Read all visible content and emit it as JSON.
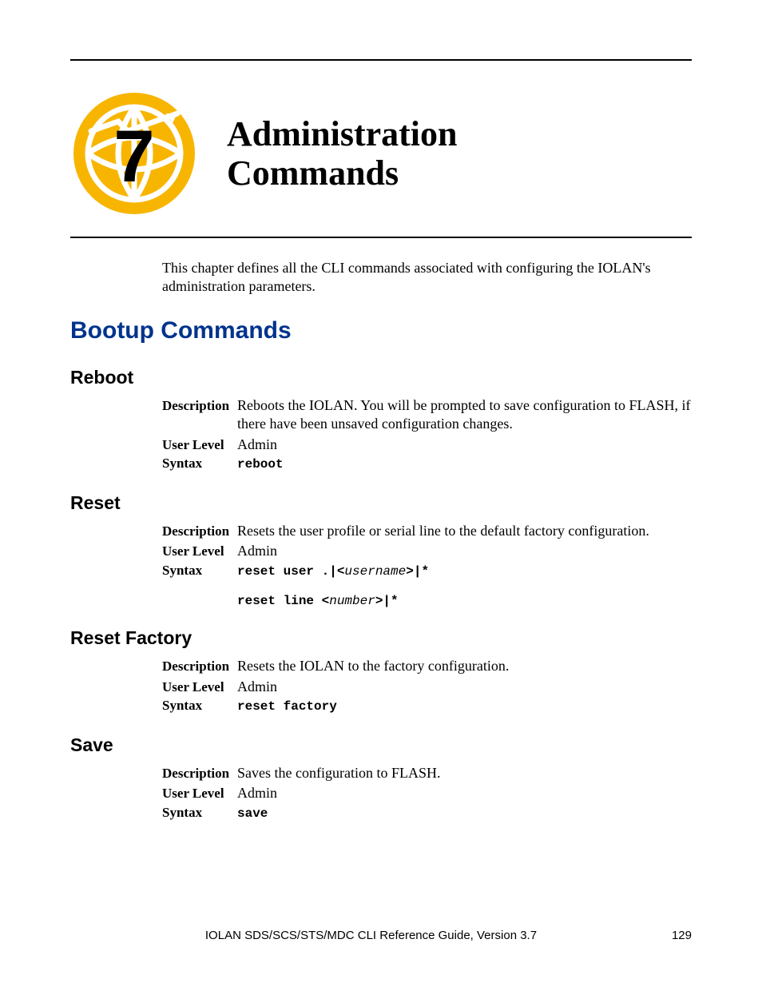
{
  "chapter": {
    "number": "7",
    "title_line1": "Administration",
    "title_line2": "Commands"
  },
  "intro": "This chapter defines all the CLI commands associated with configuring the IOLAN's administration parameters.",
  "section_title": "Bootup Commands",
  "labels": {
    "description": "Description",
    "user_level": "User Level",
    "syntax": "Syntax"
  },
  "commands": {
    "reboot": {
      "title": "Reboot",
      "description": "Reboots the IOLAN. You will be prompted to save configuration to FLASH, if there have been unsaved configuration changes.",
      "user_level": "Admin",
      "syntax": "reboot"
    },
    "reset": {
      "title": "Reset",
      "description": "Resets the user profile or serial line to the default factory configuration.",
      "user_level": "Admin",
      "syntax1_a": "reset user .|<",
      "syntax1_param": "username",
      "syntax1_b": ">|*",
      "syntax2_a": "reset line <",
      "syntax2_param": "number",
      "syntax2_b": ">|*"
    },
    "reset_factory": {
      "title": "Reset Factory",
      "description": "Resets the IOLAN to the factory configuration.",
      "user_level": "Admin",
      "syntax": "reset factory"
    },
    "save": {
      "title": "Save",
      "description": "Saves the configuration to FLASH.",
      "user_level": "Admin",
      "syntax": "save"
    }
  },
  "footer": {
    "title": "IOLAN SDS/SCS/STS/MDC CLI Reference Guide, Version 3.7",
    "page": "129"
  }
}
